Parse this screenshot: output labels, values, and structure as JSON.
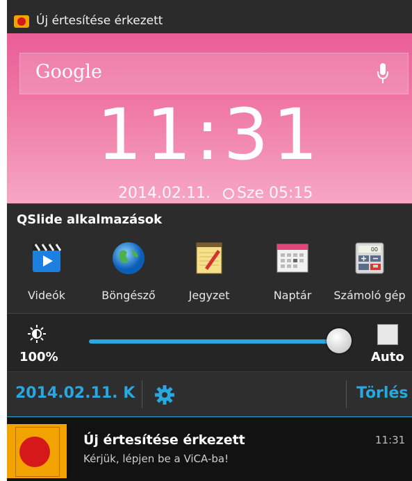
{
  "status_bar": {
    "title": "Új értesítése érkezett",
    "icon": "vica-app-icon"
  },
  "lockscreen": {
    "search_label": "Google",
    "clock": "11:31",
    "date": "2014.02.11.",
    "alarm": "Sze 05:15"
  },
  "qslide": {
    "title": "QSlide  alkalmazások",
    "apps": [
      {
        "label": "Videók",
        "icon": "video-clapper-icon"
      },
      {
        "label": "Böngésző",
        "icon": "globe-icon"
      },
      {
        "label": "Jegyzet",
        "icon": "notepad-icon"
      },
      {
        "label": "Naptár",
        "icon": "calendar-icon"
      },
      {
        "label": "Számoló gép",
        "icon": "calculator-icon"
      }
    ]
  },
  "brightness": {
    "percent_label": "100%",
    "level": 1.0,
    "auto_label": "Auto",
    "auto_checked": false
  },
  "date_bar": {
    "date": "2014.02.11. K",
    "clear_label": "Törlés"
  },
  "notification": {
    "title": "Új értesítése érkezett",
    "text": "Kérjük, lépjen be a ViCA-ba!",
    "time": "11:31"
  },
  "colors": {
    "accent": "#29a8e0",
    "wallpaper": "#ef6fa0",
    "vica_orange": "#f2a300",
    "vica_red": "#d5181a"
  }
}
